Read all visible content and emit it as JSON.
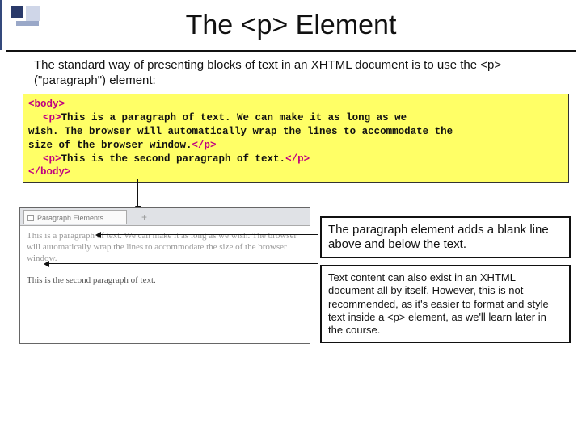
{
  "title": "The <p> Element",
  "intro": "The standard way of presenting blocks of text in an XHTML document is to use the <p> (\"paragraph\") element:",
  "code": {
    "body_open": "<body>",
    "p_open": "<p>",
    "p1_text": "This is a paragraph of text. We can make it as long as we",
    "p1_cont1": "wish. The browser will automatically wrap the lines to accommodate the",
    "p1_cont2": "size of the browser window.",
    "p_close": "</p>",
    "p2_text": "This is the second paragraph of text.",
    "body_close": "</body>"
  },
  "browser": {
    "tab_label": "Paragraph Elements",
    "plus": "+",
    "rendered_p1": "This is a paragraph of text. We can make it as long as we wish. The browser will automatically wrap the lines to accommodate the size of the browser window.",
    "rendered_p2": "This is the second paragraph of text."
  },
  "callout1": {
    "prefix": "The paragraph element adds a blank line ",
    "u1": "above",
    "mid": " and ",
    "u2": "below",
    "suffix": " the text."
  },
  "callout2": "Text content can also exist in an XHTML document all by itself.  However, this is not recommended, as it's easier to format and style text inside a <p> element, as we'll learn later in the course."
}
